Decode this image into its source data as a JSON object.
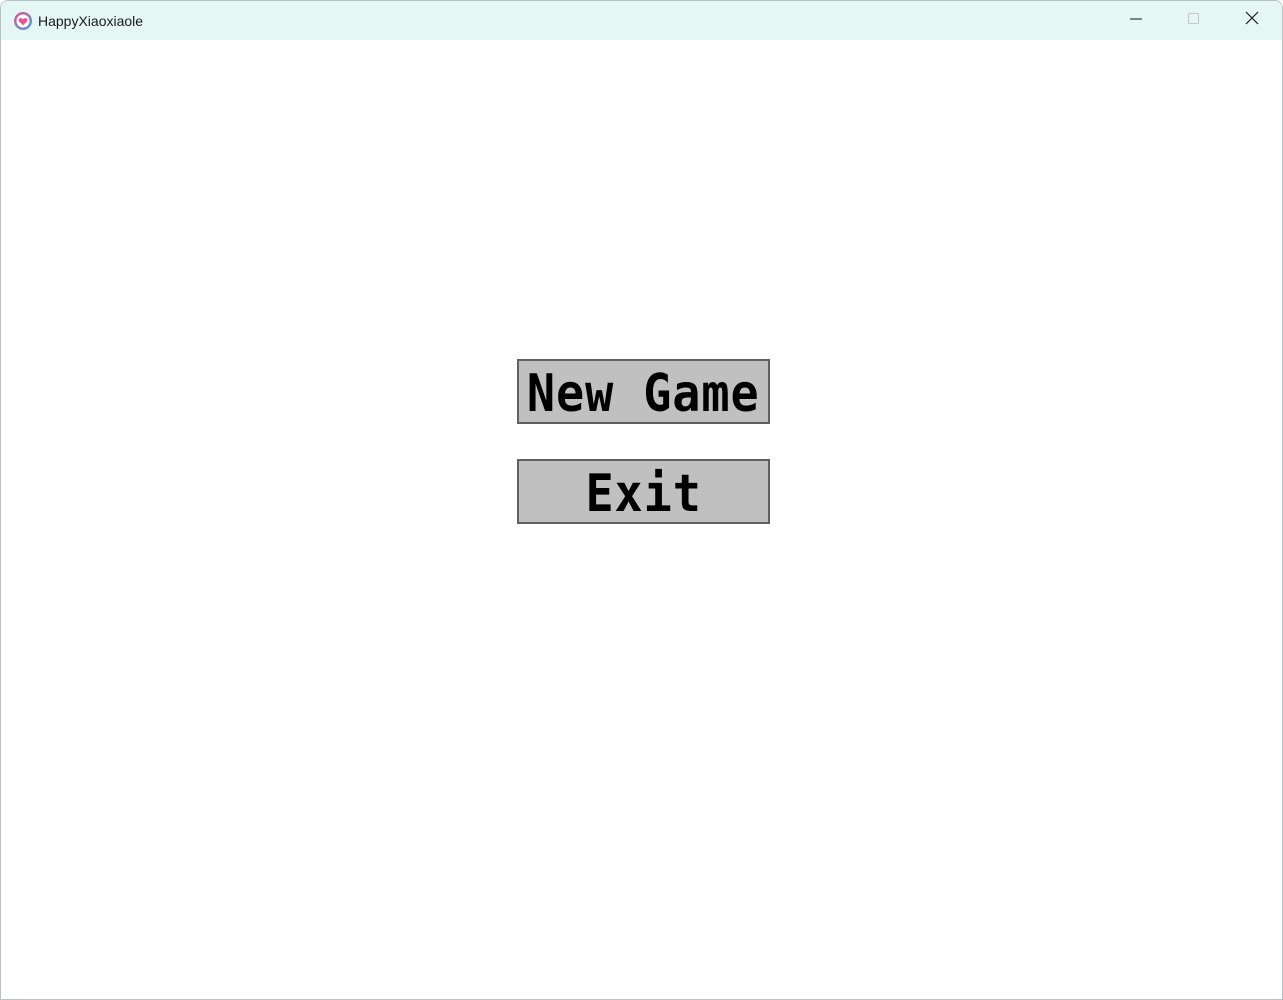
{
  "window": {
    "title": "HappyXiaoxiaole",
    "controls": {
      "minimize_icon": "minimize-icon",
      "maximize_icon": "maximize-icon",
      "close_icon": "close-icon"
    },
    "app_icon": "heart-app-icon"
  },
  "menu": {
    "new_game_label": "New Game",
    "exit_label": "Exit"
  },
  "colors": {
    "titlebar_bg": "#e4f7f5",
    "button_bg": "#c0c0c0",
    "button_border": "#606060",
    "icon_pink": "#f04e8c",
    "icon_blue": "#3aa6e6"
  }
}
